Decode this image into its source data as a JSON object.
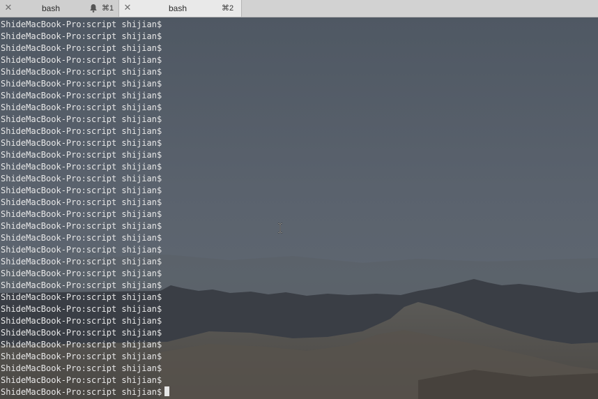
{
  "tabs": [
    {
      "title": "bash",
      "shortcut": "⌘1",
      "has_bell": true,
      "active": false,
      "close_icon": "close-icon"
    },
    {
      "title": "bash",
      "shortcut": "⌘2",
      "has_bell": false,
      "active": true,
      "close_icon": "close-icon"
    }
  ],
  "terminal": {
    "prompt": "ShideMacBook-Pro:script shijian$",
    "line_count": 32,
    "text_color": "#e8e8e8",
    "cursor_visible": true
  },
  "colors": {
    "tabbar_bg": "#d6d6d6",
    "active_tab_bg": "#e9e9e9",
    "terminal_overlay": "#4b525c"
  }
}
